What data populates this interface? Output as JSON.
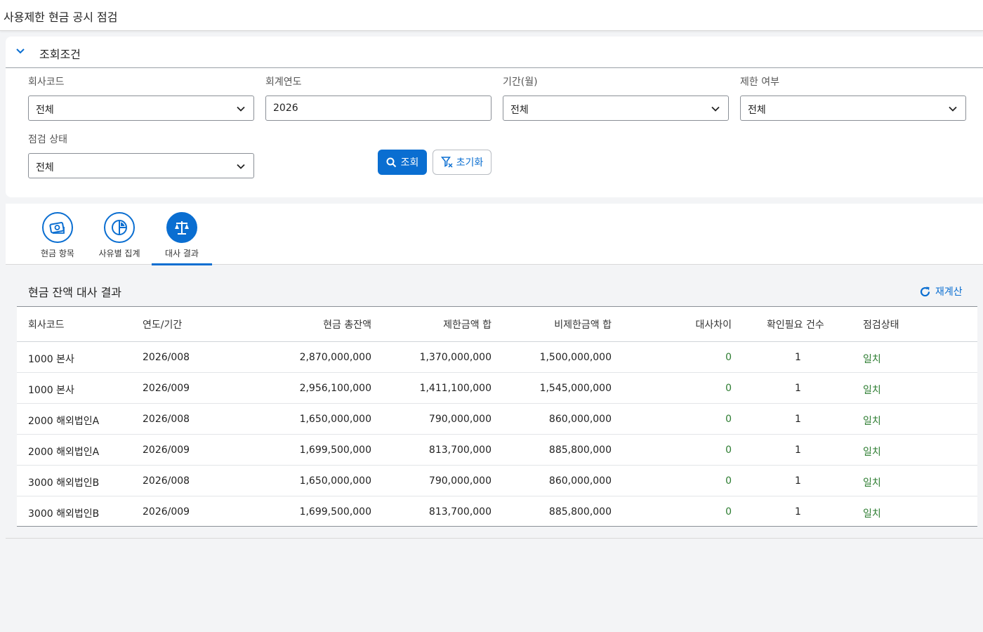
{
  "page": {
    "title": "사용제한 현금 공시 점검"
  },
  "filter": {
    "title": "조회조건",
    "company": {
      "label": "회사코드",
      "value": "전체"
    },
    "year": {
      "label": "회계연도",
      "value": "2026"
    },
    "period": {
      "label": "기간(월)",
      "value": "전체"
    },
    "restricted": {
      "label": "제한 여부",
      "value": "전체"
    },
    "status": {
      "label": "점검 상태",
      "value": "전체"
    },
    "search_label": "조회",
    "reset_label": "초기화"
  },
  "tabs": [
    {
      "label": "현금 항목",
      "icon": "cash-icon",
      "active": false
    },
    {
      "label": "사유별 집계",
      "icon": "pie-chart-icon",
      "active": false
    },
    {
      "label": "대사 결과",
      "icon": "balance-scale-icon",
      "active": true
    }
  ],
  "result": {
    "title": "현금 잔액 대사 결과",
    "recalc_label": "재계산",
    "columns": [
      "회사코드",
      "연도/기간",
      "현금 총잔액",
      "제한금액 합",
      "비제한금액 합",
      "대사차이",
      "확인필요 건수",
      "점검상태"
    ],
    "rows": [
      [
        "1000 본사",
        "2026/008",
        "2,870,000,000",
        "1,370,000,000",
        "1,500,000,000",
        "0",
        "1",
        "일치"
      ],
      [
        "1000 본사",
        "2026/009",
        "2,956,100,000",
        "1,411,100,000",
        "1,545,000,000",
        "0",
        "1",
        "일치"
      ],
      [
        "2000 해외법인A",
        "2026/008",
        "1,650,000,000",
        "790,000,000",
        "860,000,000",
        "0",
        "1",
        "일치"
      ],
      [
        "2000 해외법인A",
        "2026/009",
        "1,699,500,000",
        "813,700,000",
        "885,800,000",
        "0",
        "1",
        "일치"
      ],
      [
        "3000 해외법인B",
        "2026/008",
        "1,650,000,000",
        "790,000,000",
        "860,000,000",
        "0",
        "1",
        "일치"
      ],
      [
        "3000 해외법인B",
        "2026/009",
        "1,699,500,000",
        "813,700,000",
        "885,800,000",
        "0",
        "1",
        "일치"
      ]
    ]
  },
  "colors": {
    "accent": "#0a6ed1",
    "ok": "#2e7d32"
  }
}
